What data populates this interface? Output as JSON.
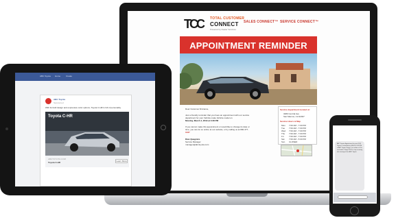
{
  "laptop_email": {
    "logo": {
      "mark": "TCC",
      "line1": "TOTAL CUSTOMER",
      "line2": "CONNECT",
      "tagline": "Powered by Dealer Services"
    },
    "product_links": [
      "SALES CONNECT™",
      "SERVICE CONNECT™"
    ],
    "banner_title": "APPOINTMENT REMINDER",
    "greeting": "Dear Customer.firstname,",
    "paragraph1_a": "Just a friendly reminder that you have an appointment with our service",
    "paragraph1_b": "department for your Vehicle.make Vehicle.model on",
    "paragraph1_date": "Monday, March 4, 2019 at 3:28 PM",
    "paragraph2_a": "If you cannot make this appointment or would like to change its date or",
    "paragraph2_b": "time, you can do so online at our website, or by calling us at 800-377-",
    "paragraph2_c": "1037",
    "signature_name": "Dian Quagmire",
    "signature_title": "Service Manager",
    "signature_email": "manager@abctoyota.com",
    "sidebar": {
      "header": "Service department located at:",
      "address_1": "3480 Central Ave",
      "address_2": "San Marcos, CA 92027",
      "hours_header": "Service Hours & Map",
      "hours": [
        {
          "day": "Mon",
          "time": "7:00 AM - 7:00 PM"
        },
        {
          "day": "Tue",
          "time": "7:00 AM - 7:00 PM"
        },
        {
          "day": "Wed",
          "time": "7:00 AM - 7:00 PM"
        },
        {
          "day": "Thu",
          "time": "7:00 AM - 7:00 PM"
        },
        {
          "day": "Fri",
          "time": "7:00 AM - 7:00 PM"
        },
        {
          "day": "Sat",
          "time": "7:00 AM - 5:00 PM"
        },
        {
          "day": "Sun",
          "time": "CLOSED"
        }
      ]
    }
  },
  "tablet_facebook": {
    "nav_items": [
      "ABC Toyota",
      "Home",
      "Create"
    ],
    "page_name": "ABC Toyota",
    "post_meta": "Sponsored",
    "post_text": "With its bold design and expressive color options, Toyota C-HR is full of personality.",
    "image_title": "Toyota C-HR",
    "link_domain": "ABCTOYOTA.COM",
    "link_title": "Toyota C-HR",
    "cta": "Learn More"
  },
  "phone_sms": {
    "message": "ABC Toyota: Appointment for your 2019 Toyota is scheduled on 03/04 at 3:28 PM at ABC Toyota. Reply C to confirm or R to reschedule. Reply STOP to stop receiving text messages from ABC Toyota."
  },
  "colors": {
    "brand_red": "#d9322c",
    "brand_orange": "#e1541e",
    "facebook_blue": "#3b5998"
  }
}
